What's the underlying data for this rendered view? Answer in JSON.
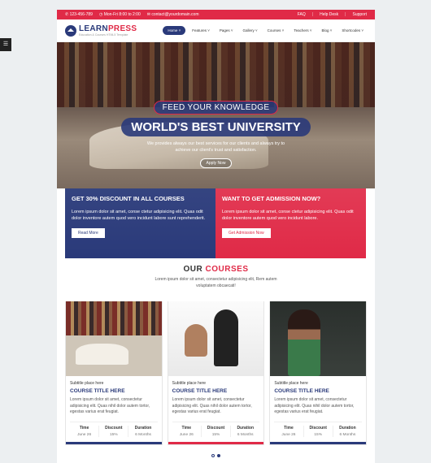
{
  "side_tab_label": "☰",
  "topbar": {
    "phone": "123-456-789",
    "hours": "Mon-Fri 8:00 to 2:00",
    "email": "contact@yourdomain.com",
    "links": [
      "FAQ",
      "Help Desk",
      "Support"
    ]
  },
  "brand": {
    "name_part1": "LEARN",
    "name_part2": "PRESS",
    "tagline": "Education & Courses HTML5 Template"
  },
  "nav": {
    "items": [
      "Home ˅",
      "Features ˅",
      "Pages ˅",
      "Gallery ˅",
      "Courses ˅",
      "Teachers ˅",
      "Blog ˅",
      "Shortcodes ˅"
    ],
    "active_index": 0
  },
  "hero": {
    "kicker": "FEED YOUR KNOWLEDGE",
    "headline": "WORLD'S BEST UNIVERSITY",
    "description": "We provides always our best services for our clients and always try to achieve our client's trust and satisfaction.",
    "button": "Apply Now"
  },
  "promos": [
    {
      "title": "GET 30% DISCOUNT IN ALL COURSES",
      "text": "Lorem ipsum dolor sit amet, conse ctetur adipisicing elit. Quas odit dolor inventore autem quod vero incidunt labore sunt reprehenderit.",
      "button": "Read More"
    },
    {
      "title": "WANT TO GET ADMISSION NOW?",
      "text": "Lorem ipsum dolor sit amet, conse ctetur adipisicing elit. Quas odit dolor inventore autem quod vero incidunt labore.",
      "button": "Get Admission Now"
    }
  ],
  "courses": {
    "title_part1": "OUR",
    "title_part2": "COURSES",
    "subtitle": "Lorem ipsum dolor sit amet, consectetur adipisicing elit, Rem autem voluptatem obcaecati!",
    "cards": [
      {
        "subtitle": "Subtitle place here",
        "title": "COURSE TITLE HERE",
        "text": "Lorem ipsum dolor sit amet, consectetur adipisicing elit. Quas nihil dolor autem tortor, egestas varius erat feugiat.",
        "meta": [
          {
            "label": "Time",
            "value": "June 26"
          },
          {
            "label": "Discount",
            "value": "15%"
          },
          {
            "label": "Duration",
            "value": "6 Months"
          }
        ],
        "stripe_color": "#2a3a7a"
      },
      {
        "subtitle": "Subtitle place here",
        "title": "COURSE TITLE HERE",
        "text": "Lorem ipsum dolor sit amet, consectetur adipisicing elit. Quas nihil dolor autem tortor, egestas varius erat feugiat.",
        "meta": [
          {
            "label": "Time",
            "value": "June 26"
          },
          {
            "label": "Discount",
            "value": "15%"
          },
          {
            "label": "Duration",
            "value": "6 Months"
          }
        ],
        "stripe_color": "#e02a47"
      },
      {
        "subtitle": "Subtitle place here",
        "title": "COURSE TITLE HERE",
        "text": "Lorem ipsum dolor sit amet, consectetur adipisicing elit. Quas nihil dolor autem tortor, egestas varius erat feugiat.",
        "meta": [
          {
            "label": "Time",
            "value": "June 26"
          },
          {
            "label": "Discount",
            "value": "15%"
          },
          {
            "label": "Duration",
            "value": "6 Months"
          }
        ],
        "stripe_color": "#2a3a7a"
      }
    ]
  },
  "carousel": {
    "count": 2,
    "active": 1
  },
  "colors": {
    "primary": "#2a3a7a",
    "accent": "#e02a47"
  }
}
